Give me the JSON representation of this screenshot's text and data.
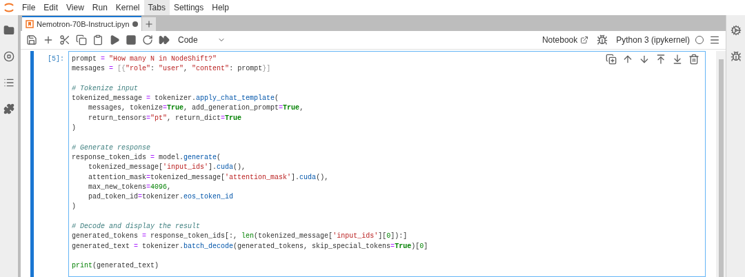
{
  "menu": [
    {
      "label": "File",
      "selected": false
    },
    {
      "label": "Edit",
      "selected": false
    },
    {
      "label": "View",
      "selected": false
    },
    {
      "label": "Run",
      "selected": false
    },
    {
      "label": "Kernel",
      "selected": false
    },
    {
      "label": "Tabs",
      "selected": true
    },
    {
      "label": "Settings",
      "selected": false
    },
    {
      "label": "Help",
      "selected": false
    }
  ],
  "tab": {
    "title": "Nemotron-70B-Instruct.ipyn",
    "unsaved": true
  },
  "toolbar": {
    "cell_type": "Code",
    "notebook_label": "Notebook",
    "kernel": "Python 3 (ipykernel)",
    "kernel_busy": false
  },
  "cell": {
    "prompt": "[5]:",
    "selected": true,
    "lines": [
      {
        "kind": "code",
        "tokens": [
          {
            "kind": "plain",
            "t": "prompt "
          },
          {
            "kind": "op",
            "t": "= "
          },
          {
            "kind": "string",
            "t": "\"How many N in NodeShift?\""
          }
        ]
      },
      {
        "kind": "code",
        "tokens": [
          {
            "kind": "plain",
            "t": "messages "
          },
          {
            "kind": "op",
            "t": "= "
          },
          {
            "kind": "bracket",
            "t": "[{"
          },
          {
            "kind": "string",
            "t": "\"role\""
          },
          {
            "kind": "plain",
            "t": ": "
          },
          {
            "kind": "string",
            "t": "\"user\""
          },
          {
            "kind": "plain",
            "t": ", "
          },
          {
            "kind": "string",
            "t": "\"content\""
          },
          {
            "kind": "plain",
            "t": ": prompt"
          },
          {
            "kind": "bracket",
            "t": "}]"
          }
        ]
      },
      {
        "kind": "blank"
      },
      {
        "kind": "code",
        "tokens": [
          {
            "kind": "comment",
            "t": "# Tokenize input"
          }
        ]
      },
      {
        "kind": "code",
        "tokens": [
          {
            "kind": "plain",
            "t": "tokenized_message "
          },
          {
            "kind": "op",
            "t": "="
          },
          {
            "kind": "plain",
            "t": " tokenizer."
          },
          {
            "kind": "func",
            "t": "apply_chat_template"
          },
          {
            "kind": "plain",
            "t": "("
          }
        ]
      },
      {
        "kind": "code",
        "tokens": [
          {
            "kind": "plain",
            "t": "    messages, tokenize"
          },
          {
            "kind": "op",
            "t": "="
          },
          {
            "kind": "keyword",
            "t": "True"
          },
          {
            "kind": "plain",
            "t": ", add_generation_prompt"
          },
          {
            "kind": "op",
            "t": "="
          },
          {
            "kind": "keyword",
            "t": "True"
          },
          {
            "kind": "plain",
            "t": ","
          }
        ]
      },
      {
        "kind": "code",
        "tokens": [
          {
            "kind": "plain",
            "t": "    return_tensors"
          },
          {
            "kind": "op",
            "t": "="
          },
          {
            "kind": "string",
            "t": "\"pt\""
          },
          {
            "kind": "plain",
            "t": ", return_dict"
          },
          {
            "kind": "op",
            "t": "="
          },
          {
            "kind": "keyword",
            "t": "True"
          }
        ]
      },
      {
        "kind": "code",
        "tokens": [
          {
            "kind": "plain",
            "t": ")"
          }
        ]
      },
      {
        "kind": "blank"
      },
      {
        "kind": "code",
        "tokens": [
          {
            "kind": "comment",
            "t": "# Generate response"
          }
        ]
      },
      {
        "kind": "code",
        "tokens": [
          {
            "kind": "plain",
            "t": "response_token_ids "
          },
          {
            "kind": "op",
            "t": "="
          },
          {
            "kind": "plain",
            "t": " model."
          },
          {
            "kind": "func",
            "t": "generate"
          },
          {
            "kind": "plain",
            "t": "("
          }
        ]
      },
      {
        "kind": "code",
        "tokens": [
          {
            "kind": "plain",
            "t": "    tokenized_message["
          },
          {
            "kind": "string",
            "t": "'input_ids'"
          },
          {
            "kind": "plain",
            "t": "]."
          },
          {
            "kind": "func",
            "t": "cuda"
          },
          {
            "kind": "plain",
            "t": "(),"
          }
        ]
      },
      {
        "kind": "code",
        "tokens": [
          {
            "kind": "plain",
            "t": "    attention_mask"
          },
          {
            "kind": "op",
            "t": "="
          },
          {
            "kind": "plain",
            "t": "tokenized_message["
          },
          {
            "kind": "string",
            "t": "'attention_mask'"
          },
          {
            "kind": "plain",
            "t": "]."
          },
          {
            "kind": "func",
            "t": "cuda"
          },
          {
            "kind": "plain",
            "t": "(),"
          }
        ]
      },
      {
        "kind": "code",
        "tokens": [
          {
            "kind": "plain",
            "t": "    max_new_tokens"
          },
          {
            "kind": "op",
            "t": "="
          },
          {
            "kind": "number",
            "t": "4096"
          },
          {
            "kind": "plain",
            "t": ","
          }
        ]
      },
      {
        "kind": "code",
        "tokens": [
          {
            "kind": "plain",
            "t": "    pad_token_id"
          },
          {
            "kind": "op",
            "t": "="
          },
          {
            "kind": "plain",
            "t": "tokenizer."
          },
          {
            "kind": "func",
            "t": "eos_token_id"
          }
        ]
      },
      {
        "kind": "code",
        "tokens": [
          {
            "kind": "plain",
            "t": ")"
          }
        ]
      },
      {
        "kind": "blank"
      },
      {
        "kind": "code",
        "tokens": [
          {
            "kind": "comment",
            "t": "# Decode and display the result"
          }
        ]
      },
      {
        "kind": "code",
        "tokens": [
          {
            "kind": "plain",
            "t": "generated_tokens "
          },
          {
            "kind": "op",
            "t": "="
          },
          {
            "kind": "plain",
            "t": " response_token_ids[:, "
          },
          {
            "kind": "builtin",
            "t": "len"
          },
          {
            "kind": "plain",
            "t": "(tokenized_message["
          },
          {
            "kind": "string",
            "t": "'input_ids'"
          },
          {
            "kind": "plain",
            "t": "]["
          },
          {
            "kind": "number",
            "t": "0"
          },
          {
            "kind": "plain",
            "t": "]):]"
          }
        ]
      },
      {
        "kind": "code",
        "tokens": [
          {
            "kind": "plain",
            "t": "generated_text "
          },
          {
            "kind": "op",
            "t": "="
          },
          {
            "kind": "plain",
            "t": " tokenizer."
          },
          {
            "kind": "func",
            "t": "batch_decode"
          },
          {
            "kind": "plain",
            "t": "(generated_tokens, skip_special_tokens"
          },
          {
            "kind": "op",
            "t": "="
          },
          {
            "kind": "keyword",
            "t": "True"
          },
          {
            "kind": "plain",
            "t": ")["
          },
          {
            "kind": "number",
            "t": "0"
          },
          {
            "kind": "plain",
            "t": "]"
          }
        ]
      },
      {
        "kind": "blank"
      },
      {
        "kind": "code",
        "tokens": [
          {
            "kind": "builtin",
            "t": "print"
          },
          {
            "kind": "plain",
            "t": "(generated_text)"
          }
        ]
      }
    ]
  }
}
